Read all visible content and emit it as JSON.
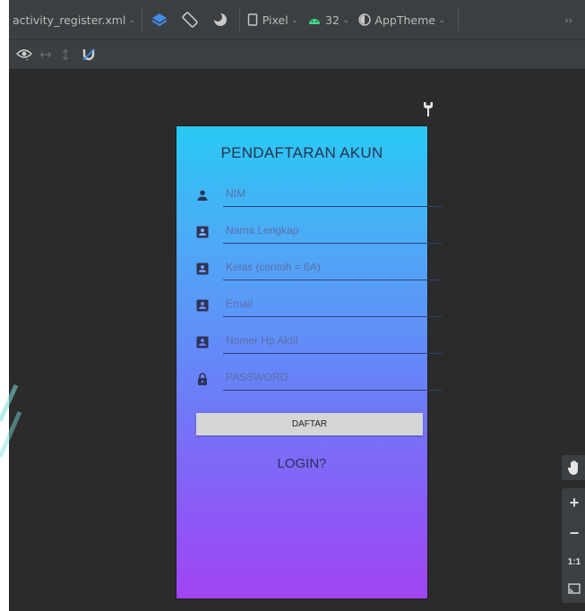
{
  "toolbar": {
    "file_tab": "activity_register.xml",
    "device": "Pixel",
    "api_level": "32",
    "theme": "AppTheme",
    "overflow": "››"
  },
  "form": {
    "title": "PENDAFTARAN AKUN",
    "fields": [
      {
        "label": "NIM",
        "icon": "person-icon"
      },
      {
        "label": "Nama Lengkap",
        "icon": "contact-card-icon"
      },
      {
        "label": "Kelas (contoh = 6A)",
        "icon": "contact-card-icon"
      },
      {
        "label": "Email",
        "icon": "contact-card-icon"
      },
      {
        "label": "Nomer Hp Aktif",
        "icon": "contact-card-icon"
      },
      {
        "label": "PASSWORD",
        "icon": "lock-icon"
      }
    ],
    "button_label": "DAFTAR",
    "link_label": "LOGIN?"
  },
  "zoom_controls": {
    "plus": "+",
    "minus": "−",
    "actual_size": "1:1"
  },
  "colors": {
    "ide_background": "#2b2b2b",
    "toolbar": "#3c3f41",
    "gradient_top": "#29c9f3",
    "gradient_bottom": "#a044f4",
    "button": "#d6d6d6"
  }
}
